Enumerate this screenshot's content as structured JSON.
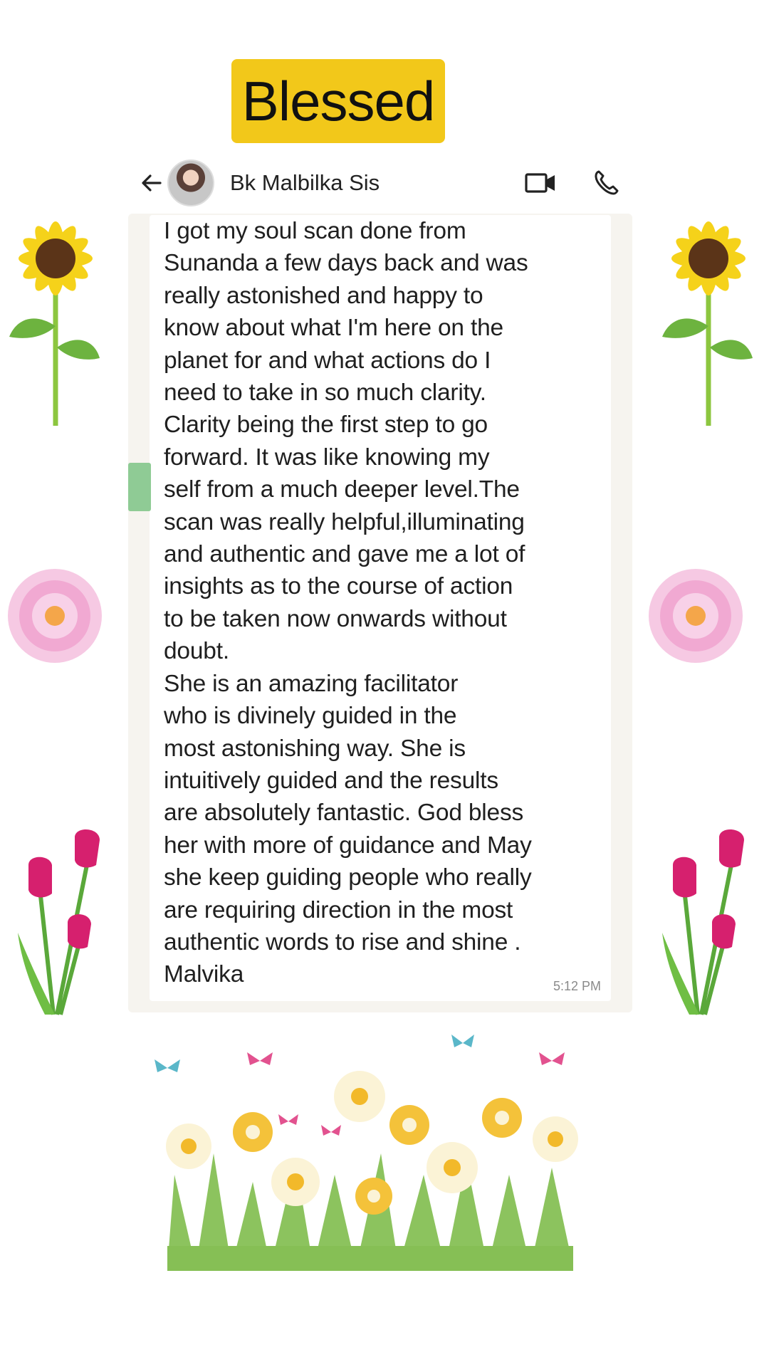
{
  "banner": {
    "title": "Blessed"
  },
  "header": {
    "contact_name": "Bk Malbilka Sis",
    "icons": [
      "back-arrow-icon",
      "avatar",
      "video-call-icon",
      "phone-call-icon"
    ]
  },
  "message": {
    "text": "I got my soul scan done from\nSunanda a few days back and was\nreally astonished and happy to\nknow about what I'm here on the\nplanet for and what actions do I\nneed to take in so much clarity.\nClarity being the first step to go\nforward. It was like knowing my\nself from a much deeper level.The\nscan was really helpful,illuminating\nand authentic and gave me a lot of\ninsights as to the course of action\nto be taken now onwards without\ndoubt.\nShe is an amazing facilitator\nwho is divinely guided in the\nmost astonishing way. She is\nintuitively guided and the results\nare absolutely fantastic. God bless\nher with more of guidance and May\nshe keep guiding people who really\nare requiring direction in the most\nauthentic words to rise and shine .\nMalvika",
    "time": "5:12 PM"
  },
  "decorations": [
    "sunflower-icon",
    "sunflower-icon",
    "pink-dahlia-icon",
    "pink-dahlia-icon",
    "tulip-icon",
    "tulip-icon",
    "flower-meadow-icon",
    "butterfly-icon"
  ],
  "colors": {
    "banner": "#f2c81a",
    "scroll_tab": "#8fcb95",
    "bubble_bg": "#f6f4ef"
  }
}
